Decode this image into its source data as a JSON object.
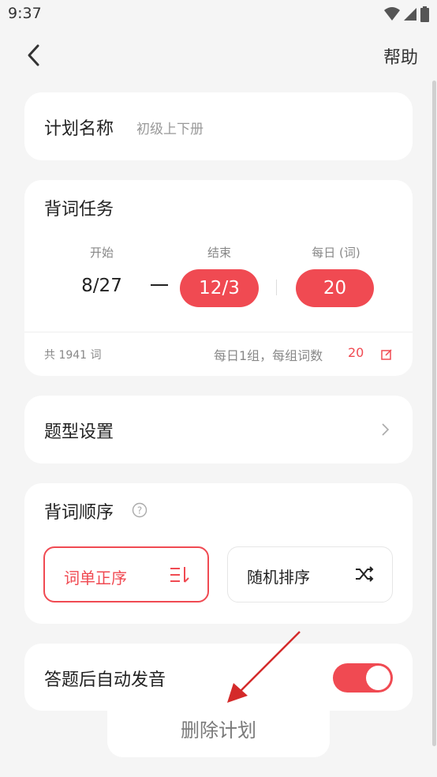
{
  "status_bar": {
    "time": "9:37"
  },
  "nav": {
    "help_label": "帮助"
  },
  "plan_name": {
    "label": "计划名称",
    "value": "初级上下册"
  },
  "task": {
    "title": "背词任务",
    "start_label": "开始",
    "end_label": "结束",
    "daily_label": "每日 (词)",
    "start_value": "8/27",
    "end_value": "12/3",
    "daily_value": "20",
    "total_words": "共 1941 词",
    "per_day_text": "每日1组，每组词数",
    "per_group_count": "20"
  },
  "question_type": {
    "label": "题型设置"
  },
  "order": {
    "title": "背词顺序",
    "sequential_label": "词单正序",
    "random_label": "随机排序",
    "selected": "sequential"
  },
  "auto_sound": {
    "label": "答题后自动发音",
    "enabled": true
  },
  "delete": {
    "label": "删除计划"
  },
  "colors": {
    "accent": "#f04a52",
    "background": "#f5f5f5",
    "card": "#ffffff"
  },
  "icons": {
    "back": "back-arrow-icon",
    "chevron": "chevron-right-icon",
    "help": "help-circle-icon",
    "edit": "edit-icon",
    "sequential": "sort-order-icon",
    "random": "shuffle-icon"
  }
}
